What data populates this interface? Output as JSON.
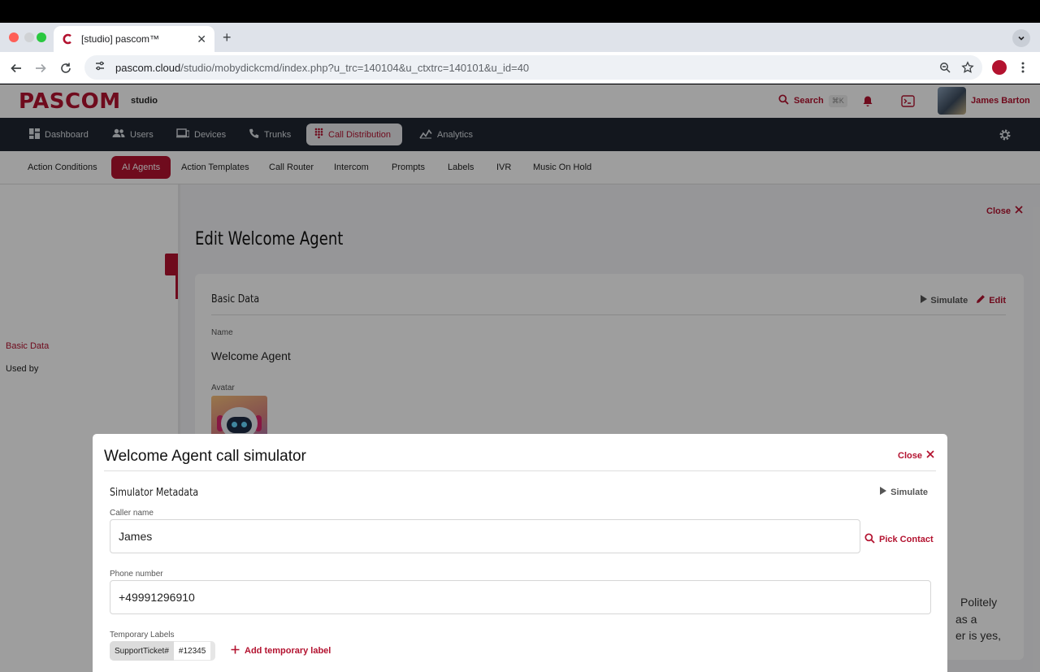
{
  "browser": {
    "tab_title": "[studio] pascom™",
    "url_host": "pascom.cloud",
    "url_path": "/studio/mobydickcmd/index.php?u_trc=140104&u_ctxtrc=140101&u_id=40"
  },
  "header": {
    "logo": "PASCOM",
    "product": "studio",
    "search_label": "Search",
    "search_shortcut": "⌘K",
    "user_name": "James Barton"
  },
  "main_nav": {
    "items": [
      {
        "label": "Dashboard",
        "icon": "dashboard-icon"
      },
      {
        "label": "Users",
        "icon": "users-icon"
      },
      {
        "label": "Devices",
        "icon": "devices-icon"
      },
      {
        "label": "Trunks",
        "icon": "phone-icon"
      },
      {
        "label": "Call Distribution",
        "icon": "grid-dots-icon",
        "active": true
      },
      {
        "label": "Analytics",
        "icon": "analytics-icon"
      }
    ]
  },
  "sub_nav": {
    "items": [
      {
        "label": "Action Conditions"
      },
      {
        "label": "AI Agents",
        "active": true
      },
      {
        "label": "Action Templates"
      },
      {
        "label": "Call Router"
      },
      {
        "label": "Intercom"
      },
      {
        "label": "Prompts"
      },
      {
        "label": "Labels"
      },
      {
        "label": "IVR"
      },
      {
        "label": "Music On Hold"
      }
    ]
  },
  "left_menu": {
    "items": [
      {
        "label": "Basic Data",
        "active": true
      },
      {
        "label": "Used by"
      }
    ]
  },
  "page": {
    "close_label": "Close",
    "title": "Edit Welcome Agent",
    "card": {
      "title": "Basic Data",
      "simulate_label": "Simulate",
      "edit_label": "Edit",
      "name_label": "Name",
      "name_value": "Welcome Agent",
      "avatar_label": "Avatar",
      "prompt_fragment_1": "Politely",
      "prompt_fragment_2": "as a",
      "prompt_fragment_3": "er is yes,"
    }
  },
  "modal": {
    "title": "Welcome Agent call simulator",
    "close_label": "Close",
    "section_title": "Simulator Metadata",
    "simulate_label": "Simulate",
    "caller_name_label": "Caller name",
    "caller_name_value": "James",
    "pick_contact_label": "Pick Contact",
    "phone_label": "Phone number",
    "phone_value": "+49991296910",
    "temp_labels_label": "Temporary Labels",
    "chip_key": "SupportTicket#",
    "chip_value": "#12345",
    "add_label": "Add temporary label"
  },
  "colors": {
    "brand": "#b3122f",
    "nav_bg": "#1f2631"
  }
}
